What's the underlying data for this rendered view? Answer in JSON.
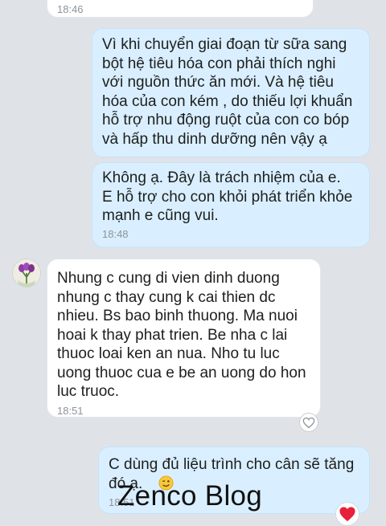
{
  "messages": [
    {
      "text": "",
      "time": "18:46"
    },
    {
      "text": "Vì khi chuyển giai đoạn từ sữa sang\nbột hệ tiêu hóa con phải thích nghi\nvới nguồn thức ăn mới. Và hệ tiêu\nhóa của con kém , do thiếu lợi khuẩn\nhỗ trợ nhu động ruột của con co bóp\nvà hấp thu dinh dưỡng nên vậy ạ",
      "time": ""
    },
    {
      "text": "Không ạ. Đây là trách nhiệm của e.\nE hỗ trợ cho con khỏi phát triển khỏe\nmạnh e cũng vui.",
      "time": "18:48"
    },
    {
      "text": "Nhung c cung di vien dinh duong\nnhung c thay cung k cai thien dc\nnhieu. Bs bao binh thuong. Ma nuoi\nhoai k thay phat trien. Be nha c lai\nthuoc loai ken an nua. Nho tu luc\nuong thuoc cua e be an uong do hon\nluc truoc.",
      "time": "18:51"
    },
    {
      "text": "C dùng đủ liệu trình cho cân sẽ tăng\nđó ạ.",
      "time": "18:51"
    }
  ],
  "watermark": "Zenco Blog",
  "colors": {
    "background": "#dfe3e8",
    "outgoing_bubble": "#d9efff",
    "incoming_bubble": "#ffffff",
    "heart": "#e8203a"
  },
  "icons": {
    "reaction_empty": "heart-outline-icon",
    "reaction_filled": "heart-icon",
    "emoji": "wink-emoji-icon",
    "avatar": "flower-avatar-icon"
  }
}
